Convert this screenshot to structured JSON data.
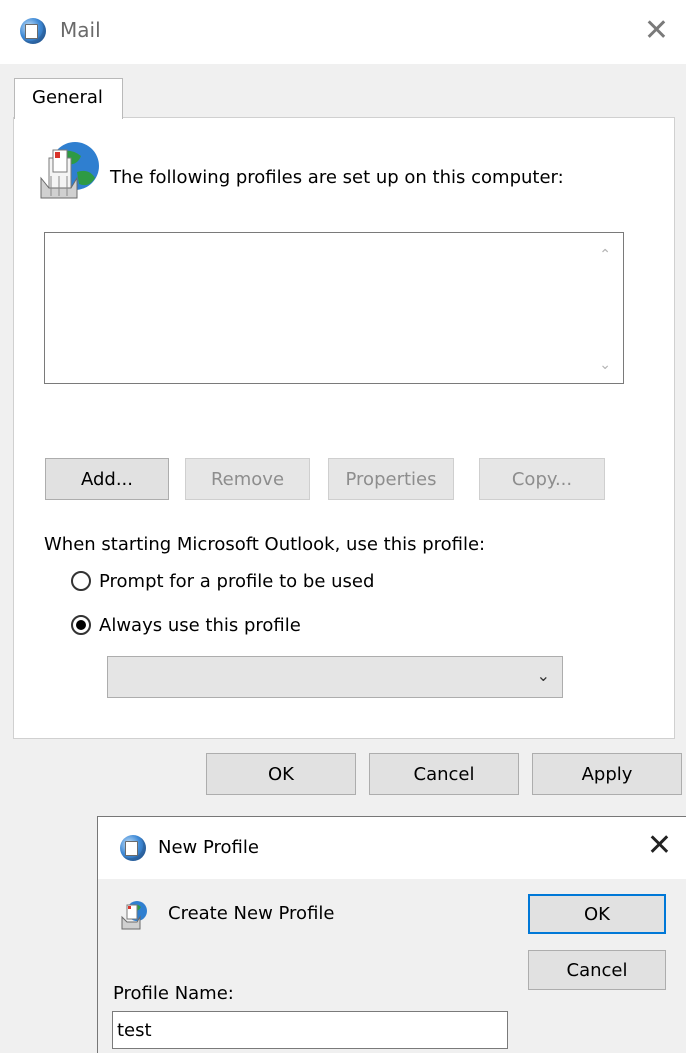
{
  "mail_window": {
    "title": "Mail",
    "close_glyph": "✕",
    "tab_label": "General",
    "profiles_heading": "The following profiles are set up on this computer:",
    "profiles": [],
    "buttons": {
      "add": "Add...",
      "remove": "Remove",
      "properties": "Properties",
      "copy": "Copy..."
    },
    "startup_label": "When starting Microsoft Outlook, use this profile:",
    "radio_prompt": "Prompt for a profile to be used",
    "radio_always": "Always use this profile",
    "selected_radio": "always",
    "profile_select_value": "",
    "footer": {
      "ok": "OK",
      "cancel": "Cancel",
      "apply": "Apply"
    }
  },
  "new_profile_dialog": {
    "title": "New Profile",
    "close_glyph": "✕",
    "create_label": "Create New Profile",
    "ok": "OK",
    "cancel": "Cancel",
    "name_label": "Profile Name:",
    "name_value": "test"
  },
  "icons": {
    "app": "mail-globe-icon",
    "profiles": "profiles-globe-icon",
    "create": "create-profile-icon"
  },
  "colors": {
    "focus_border": "#0078d7",
    "disabled_text": "#8d8d8d"
  }
}
